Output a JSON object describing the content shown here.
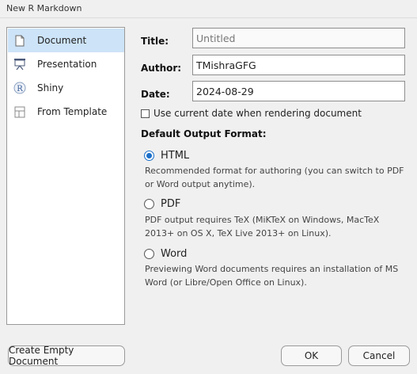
{
  "window": {
    "title": "New R Markdown"
  },
  "sidebar": {
    "items": [
      {
        "label": "Document",
        "icon": "document-icon",
        "selected": true
      },
      {
        "label": "Presentation",
        "icon": "presentation-icon",
        "selected": false
      },
      {
        "label": "Shiny",
        "icon": "shiny-r-icon",
        "selected": false
      },
      {
        "label": "From Template",
        "icon": "template-icon",
        "selected": false
      }
    ]
  },
  "form": {
    "title_label": "Title:",
    "title_placeholder": "Untitled",
    "author_label": "Author:",
    "author_value": "TMishraGFG",
    "date_label": "Date:",
    "date_value": "2024-08-29",
    "use_current_date_label": "Use current date when rendering document",
    "use_current_date_checked": false
  },
  "output": {
    "section_label": "Default Output Format:",
    "options": [
      {
        "label": "HTML",
        "selected": true,
        "desc": "Recommended format for authoring (you can switch to PDF or Word output anytime)."
      },
      {
        "label": "PDF",
        "selected": false,
        "desc": "PDF output requires TeX (MiKTeX on Windows, MacTeX 2013+ on OS X, TeX Live 2013+ on Linux)."
      },
      {
        "label": "Word",
        "selected": false,
        "desc": "Previewing Word documents requires an installation of MS Word (or Libre/Open Office on Linux)."
      }
    ]
  },
  "buttons": {
    "create_empty": "Create Empty Document",
    "ok": "OK",
    "cancel": "Cancel"
  },
  "colors": {
    "selection": "#cde3f7",
    "radio_accent": "#1a6fc9"
  }
}
